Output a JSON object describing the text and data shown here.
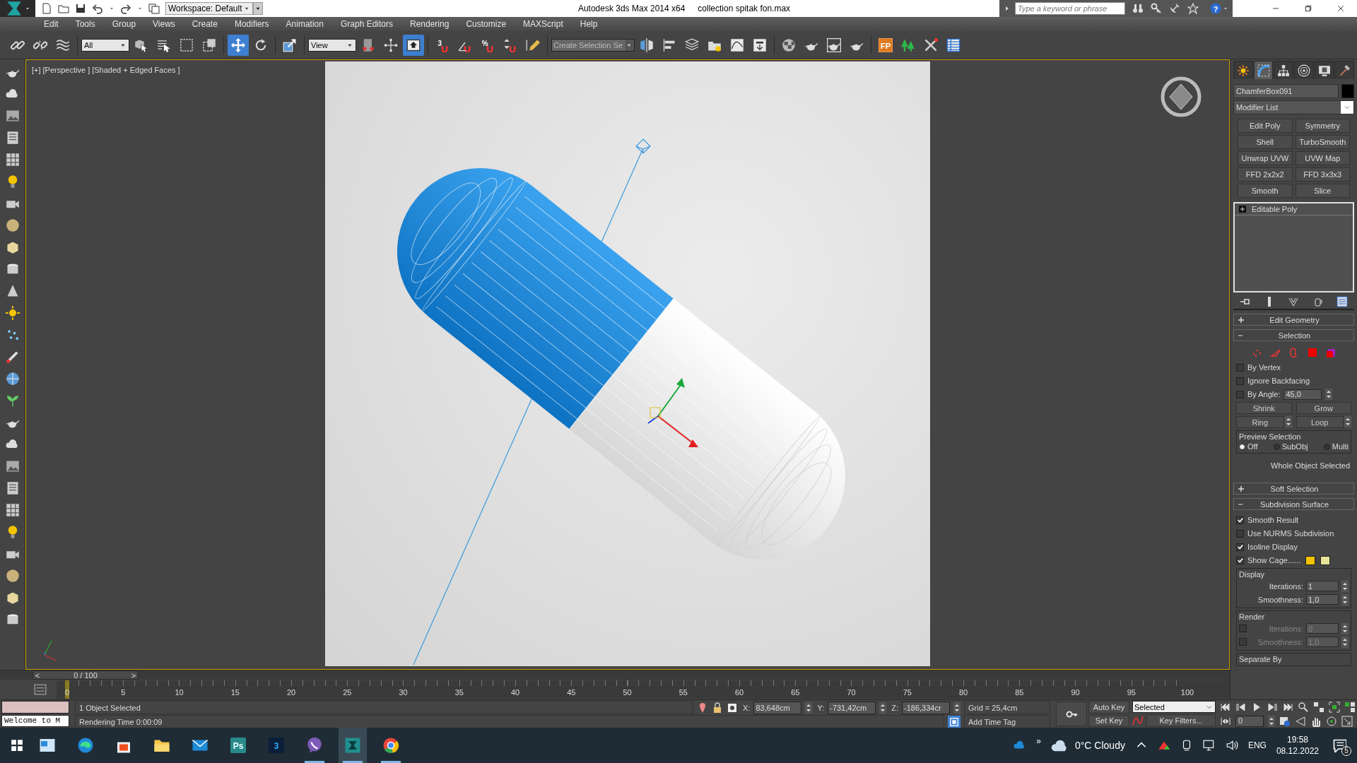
{
  "title_bar": {
    "workspace": "Workspace: Default",
    "app_title": "Autodesk 3ds Max  2014 x64",
    "file_name": "collection spitak  fon.max",
    "search": {
      "placeholder": "Type a keyword or phrase"
    },
    "help": "?"
  },
  "menu": [
    "Edit",
    "Tools",
    "Group",
    "Views",
    "Create",
    "Modifiers",
    "Animation",
    "Graph Editors",
    "Rendering",
    "Customize",
    "MAXScript",
    "Help"
  ],
  "toolbar": [
    {
      "kind": "link",
      "selected": false
    },
    {
      "kind": "unlink",
      "selected": false
    },
    {
      "kind": "bind",
      "selected": false
    },
    {
      "kind": "dropdown",
      "value": "All"
    },
    {
      "kind": "select",
      "selected": false
    },
    {
      "kind": "select-name",
      "selected": false
    },
    {
      "kind": "region",
      "selected": false
    },
    {
      "kind": "window",
      "selected": false
    },
    {
      "kind": "move",
      "selected": true
    },
    {
      "kind": "rotate",
      "selected": false
    },
    {
      "kind": "scale",
      "selected": false
    },
    {
      "kind": "dropdown",
      "value": "View"
    },
    {
      "kind": "pivot",
      "selected": false
    },
    {
      "kind": "manipulate",
      "selected": false
    },
    {
      "kind": "keyboard",
      "selected": true
    },
    {
      "kind": "snap",
      "label": "3",
      "selected": false
    },
    {
      "kind": "angle-snap",
      "selected": false
    },
    {
      "kind": "percent-snap",
      "label": "%",
      "selected": false
    },
    {
      "kind": "spinner-snap",
      "selected": false
    },
    {
      "kind": "named-sets",
      "selected": false
    },
    {
      "kind": "combo",
      "placeholder": "Create Selection Se"
    },
    {
      "kind": "mirror",
      "selected": false
    },
    {
      "kind": "align",
      "selected": false
    },
    {
      "kind": "layers",
      "selected": false
    },
    {
      "kind": "layer-manager",
      "selected": false
    },
    {
      "kind": "curve",
      "selected": false
    },
    {
      "kind": "schematic",
      "selected": false
    },
    {
      "kind": "material",
      "selected": false
    },
    {
      "kind": "render-setup",
      "selected": false
    },
    {
      "kind": "render-frame",
      "selected": false
    },
    {
      "kind": "render",
      "selected": false
    },
    {
      "kind": "plugin",
      "label": "FP",
      "selected": false
    },
    {
      "kind": "trees",
      "selected": false
    },
    {
      "kind": "tools",
      "selected": false
    },
    {
      "kind": "table",
      "selected": false
    }
  ],
  "viewport": {
    "labels": [
      "[+]",
      "[Perspective ]",
      "[Shaded + Edged Faces ]"
    ]
  },
  "command_panel": {
    "tabs": [
      {
        "kind": "create",
        "selected": false
      },
      {
        "kind": "modify",
        "selected": true
      },
      {
        "kind": "hierarchy",
        "selected": false
      },
      {
        "kind": "motion",
        "selected": false
      },
      {
        "kind": "display",
        "selected": false
      },
      {
        "kind": "utilities",
        "selected": false
      }
    ],
    "object_name": "ChamferBox091",
    "modifier_list": "Modifier List",
    "modifier_buttons": [
      "Edit Poly",
      "Symmetry",
      "Shell",
      "TurboSmooth",
      "Unwrap UVW",
      "UVW Map",
      "FFD 2x2x2",
      "FFD 3x3x3",
      "Smooth",
      "Slice"
    ],
    "stack": [
      {
        "label": "Editable Poly",
        "expanded": false
      }
    ],
    "rollouts": [
      {
        "title": "Edit Geometry",
        "expanded": false
      },
      {
        "kind": "selection",
        "title": "Selection",
        "expanded": true,
        "levels": [
          {
            "kind": "vertex",
            "selected": false
          },
          {
            "kind": "edge",
            "selected": false
          },
          {
            "kind": "border",
            "selected": false
          },
          {
            "kind": "polygon",
            "selected": false
          },
          {
            "kind": "element",
            "selected": false
          }
        ],
        "options": [
          {
            "label": "By Vertex",
            "checked": false
          },
          {
            "label": "Ignore Backfacing",
            "checked": false
          },
          {
            "label": "By Angle:",
            "checked": false,
            "value": "45,0"
          }
        ],
        "buttons": [
          {
            "label": "Shrink",
            "spinner": false
          },
          {
            "label": "Grow",
            "spinner": false
          },
          {
            "label": "Ring",
            "spinner": true
          },
          {
            "label": "Loop",
            "spinner": true
          }
        ],
        "preview": {
          "title": "Preview Selection",
          "options": [
            {
              "label": "Off",
              "selected": true
            },
            {
              "label": "SubObj",
              "selected": false
            },
            {
              "label": "Multi",
              "selected": false
            }
          ]
        },
        "status": "Whole Object Selected"
      },
      {
        "title": "Soft Selection",
        "expanded": false
      },
      {
        "kind": "subdivision",
        "title": "Subdivision Surface",
        "expanded": true,
        "options": [
          {
            "label": "Smooth Result",
            "checked": true
          },
          {
            "label": "Use NURMS Subdivision",
            "checked": false
          },
          {
            "label": "Isoline Display",
            "checked": true
          },
          {
            "label": "Show Cage......",
            "checked": true
          }
        ],
        "cage_colors": [
          {
            "color": "#f5c400"
          },
          {
            "color": "#e8e49a"
          }
        ],
        "groups": [
          {
            "title": "Display",
            "fields": [
              {
                "label": "Iterations:",
                "value": "1",
                "disabled": false
              },
              {
                "label": "Smoothness:",
                "value": "1,0",
                "disabled": false
              }
            ]
          },
          {
            "title": "Render",
            "fields": [
              {
                "label": "Iterations:",
                "value": "0",
                "disabled": true,
                "checked": false
              },
              {
                "label": "Smoothness:",
                "value": "1,0",
                "disabled": true,
                "checked": false
              }
            ]
          },
          {
            "title": "Separate By"
          }
        ]
      }
    ]
  },
  "timeline": {
    "level": 0,
    "previous": "<",
    "frame": "0 / 100",
    "next": ">",
    "ticks": [
      "0",
      "5",
      "10",
      "15",
      "20",
      "25",
      "30",
      "35",
      "40",
      "45",
      "50",
      "55",
      "60",
      "65",
      "70",
      "75",
      "80",
      "85",
      "90",
      "95",
      "100"
    ]
  },
  "status_bar": {
    "listener_output": "Welcome to M",
    "prompt": "1 Object Selected",
    "info": "Rendering Time  0:00:09",
    "x_label": "X:",
    "x": "83,648cm",
    "y_label": "Y:",
    "y": "-731,42cm",
    "z_label": "Z:",
    "z": "-186,334cr",
    "grid": "Grid = 25,4cm",
    "time_tag": "Add Time Tag",
    "auto_key": "Auto Key",
    "key_mode": "Selected",
    "set_key": "Set Key",
    "key_filters": "Key Filters...",
    "current_frame": "0"
  },
  "taskbar": {
    "apps": [
      {
        "kind": "widgets",
        "running": false,
        "selected": false
      },
      {
        "kind": "edge",
        "running": false,
        "selected": false
      },
      {
        "kind": "store",
        "running": false,
        "selected": false
      },
      {
        "kind": "explorer",
        "running": false,
        "selected": false
      },
      {
        "kind": "mail",
        "running": false,
        "selected": false
      },
      {
        "kind": "labelled",
        "label": "Ps",
        "running": false,
        "selected": false
      },
      {
        "kind": "labelled",
        "label": "3",
        "running": false,
        "selected": false
      },
      {
        "kind": "viber",
        "running": true,
        "selected": false
      },
      {
        "kind": "max",
        "running": true,
        "selected": true
      },
      {
        "kind": "chrome",
        "running": true,
        "selected": false
      }
    ],
    "overflow": "»",
    "weather": "0°C  Cloudy",
    "language": "ENG",
    "time": "19:58",
    "date": "08.12.2022",
    "notifications": "5"
  }
}
